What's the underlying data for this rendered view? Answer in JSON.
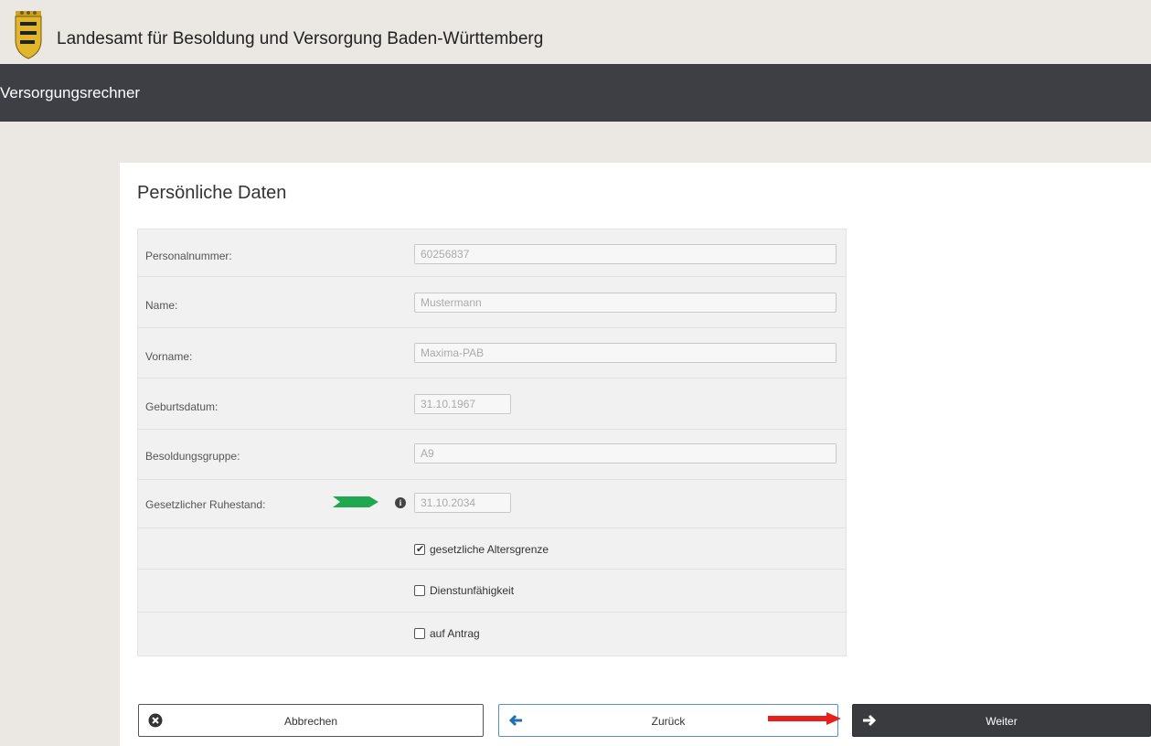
{
  "header": {
    "title": "Landesamt für Besoldung und Versorgung Baden-Württemberg"
  },
  "navbar": {
    "title": "Versorgungsrechner"
  },
  "section": {
    "title": "Persönliche Daten"
  },
  "form": {
    "personalnummer": {
      "label": "Personalnummer:",
      "value": "60256837"
    },
    "name": {
      "label": "Name:",
      "value": "Mustermann"
    },
    "vorname": {
      "label": "Vorname:",
      "value": "Maxima-PAB"
    },
    "geburtsdatum": {
      "label": "Geburtsdatum:",
      "value": "31.10.1967"
    },
    "besoldungsgruppe": {
      "label": "Besoldungsgruppe:",
      "value": "A9"
    },
    "ruhestand": {
      "label": "Gesetzlicher Ruhestand:",
      "value": "31.10.2034",
      "info_icon": "info-icon"
    }
  },
  "options": [
    {
      "label": "gesetzliche Altersgrenze",
      "checked": true
    },
    {
      "label": "Dienstunfähigkeit",
      "checked": false
    },
    {
      "label": "auf Antrag",
      "checked": false
    }
  ],
  "buttons": {
    "cancel": {
      "label": "Abbrechen",
      "icon": "close-circle-icon"
    },
    "back": {
      "label": "Zurück",
      "icon": "arrow-left-icon"
    },
    "next": {
      "label": "Weiter",
      "icon": "arrow-right-icon"
    }
  },
  "colors": {
    "navbar": "#3d3f44",
    "green_arrow": "#1fa84f",
    "red_arrow": "#e8201b",
    "back_accent": "#1e6fb8"
  }
}
